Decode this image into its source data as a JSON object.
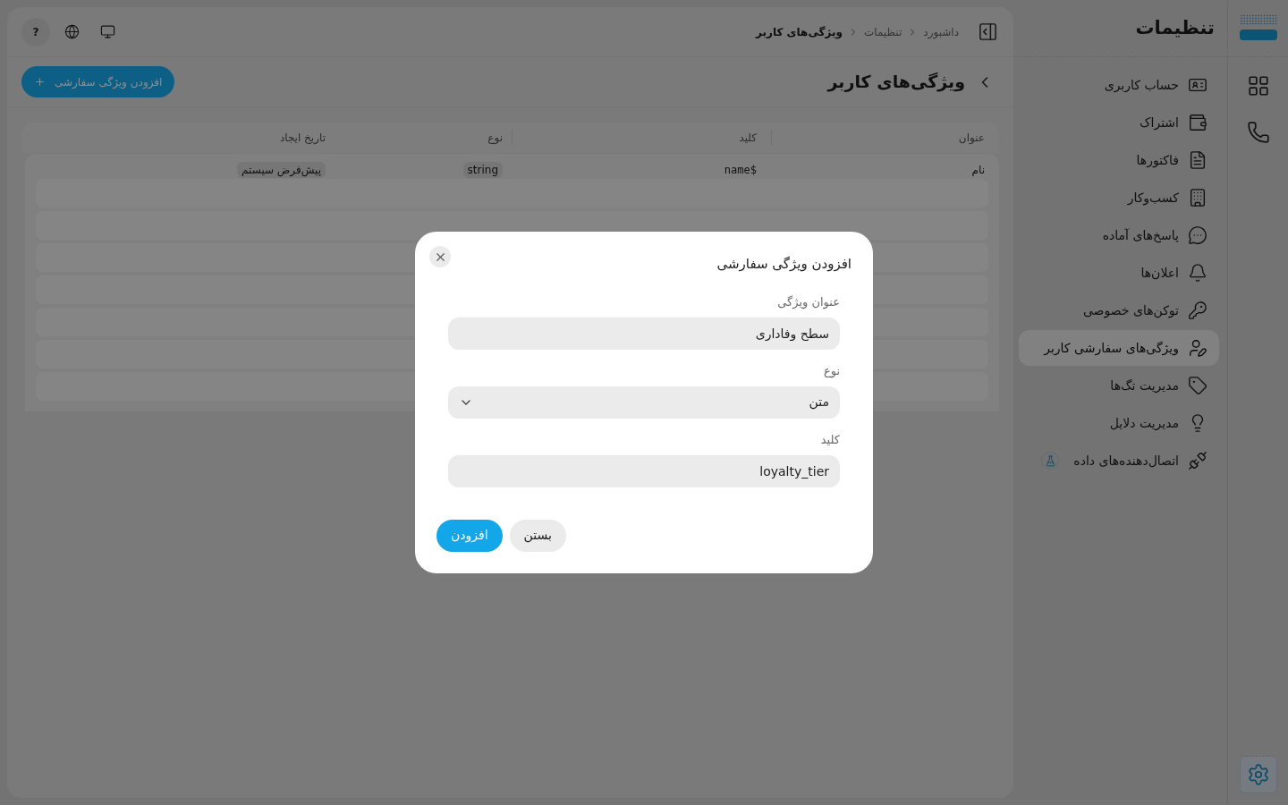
{
  "rail": {
    "items": [
      {
        "selected": false
      },
      {
        "selected": false
      },
      {
        "selected": true
      }
    ]
  },
  "sidebar": {
    "title": "تنظیمات",
    "items": [
      {
        "label": "حساب کاربری",
        "selected": false,
        "experimental": false
      },
      {
        "label": "اشتراک",
        "selected": false,
        "experimental": false
      },
      {
        "label": "فاکتورها",
        "selected": false,
        "experimental": false
      },
      {
        "label": "کسب‌وکار",
        "selected": false,
        "experimental": false
      },
      {
        "label": "پاسخ‌های آماده",
        "selected": false,
        "experimental": false
      },
      {
        "label": "اعلان‌ها",
        "selected": false,
        "experimental": false
      },
      {
        "label": "توکن‌های خصوصی",
        "selected": false,
        "experimental": false
      },
      {
        "label": "ویژگی‌های سفارشی کاربر",
        "selected": true,
        "experimental": false
      },
      {
        "label": "مدیریت تگ‌ها",
        "selected": false,
        "experimental": false
      },
      {
        "label": "مدیریت دلایل",
        "selected": false,
        "experimental": false
      },
      {
        "label": "اتصال‌دهنده‌های داده",
        "selected": false,
        "experimental": true
      }
    ]
  },
  "header": {
    "breadcrumb": [
      {
        "label": "داشبورد",
        "current": false
      },
      {
        "label": "تنظیمات",
        "current": false
      },
      {
        "label": "ویژگی‌های کاربر",
        "current": true
      }
    ],
    "help": "?"
  },
  "page": {
    "title": "ویژگی‌های کاربر",
    "add_button": "افزودن ویژگی سفارشی"
  },
  "table": {
    "columns": [
      "عنوان",
      "کلید",
      "نوع",
      "تاریخ ایجاد"
    ],
    "rows": [
      {
        "cells": [
          {
            "text": "نام",
            "kind": "plain"
          },
          {
            "text": "$name",
            "kind": "code"
          },
          {
            "text": "string",
            "kind": "badge"
          },
          {
            "text": "پیش‌فرض سیستم",
            "kind": "badge"
          }
        ]
      }
    ],
    "placeholder_rows": [
      {
        "kind": "skeleton"
      },
      {
        "kind": "skeleton"
      },
      {
        "kind": "skeleton"
      },
      {
        "kind": "skeleton"
      },
      {
        "kind": "skeleton"
      },
      {
        "kind": "skeleton"
      },
      {
        "kind": "skeleton"
      }
    ]
  },
  "dialog": {
    "open": true,
    "title": "افزودن ویژگی سفارشی",
    "fields": [
      {
        "label": "عنوان ویژگی",
        "kind": "text",
        "value": "سطح وفاداری"
      },
      {
        "label": "نوع",
        "kind": "select",
        "value": "متن"
      },
      {
        "label": "کلید",
        "kind": "text",
        "value": "loyalty_tier"
      }
    ],
    "buttons": [
      {
        "label": "بستن",
        "kind": "secondary"
      },
      {
        "label": "افزودن",
        "kind": "primary"
      }
    ]
  }
}
